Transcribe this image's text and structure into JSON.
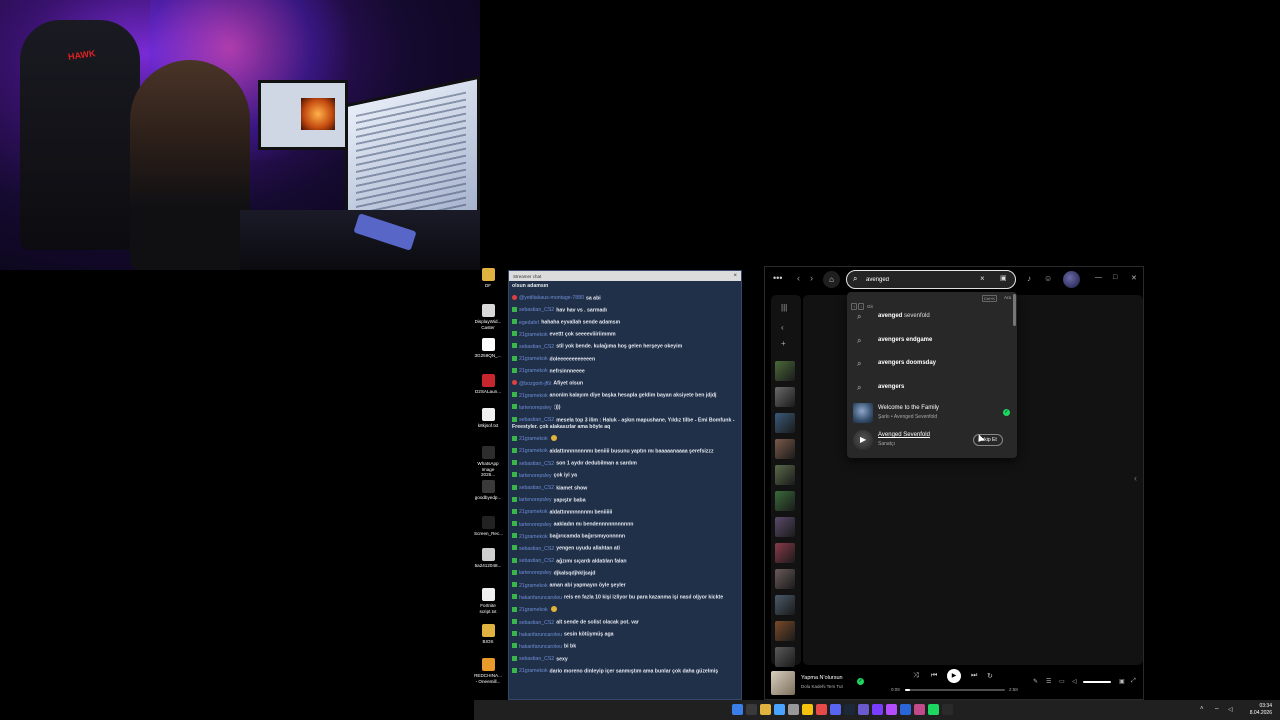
{
  "chat": {
    "title": "Streamer chat",
    "messages": [
      {
        "badge": "",
        "user": "",
        "text": "olsun adamsın"
      },
      {
        "badge": "red",
        "user": "@yetiltakaus-montage-7880",
        "text": "sa abi"
      },
      {
        "badge": "green",
        "user": "sebastian_CS2",
        "text": "hav hav vs . sarmadı"
      },
      {
        "badge": "green",
        "user": "egedahrl",
        "text": "hahaha eyvallah sende adamsın"
      },
      {
        "badge": "green",
        "user": "21gramekok",
        "text": "evettt çok seeeeviiiriimmm"
      },
      {
        "badge": "green",
        "user": "sebastian_CS2",
        "text": "stil yok bende. kulağıma hoş gelen herşeye okeyim"
      },
      {
        "badge": "green",
        "user": "21gramekok",
        "text": "doleeeeeeeeeeeen"
      },
      {
        "badge": "green",
        "user": "21gramekok",
        "text": "nefrsinnneeee"
      },
      {
        "badge": "red",
        "user": "@bozgorit-jf6t",
        "text": "Afiyet olsun"
      },
      {
        "badge": "green",
        "user": "21gramekok",
        "text": "anonim kalayım diye başka hesapla geldim bayan aksiyete ben jdjdj"
      },
      {
        "badge": "green",
        "user": "lartenorepsley",
        "text": ":)))"
      },
      {
        "badge": "green",
        "user": "sebastian_CS2",
        "text": "mesela top 3 ilim : Haluk - aşkın mapushane, Yıldız tilbe - Emi Bomfunk - Freestyler. çok alakasızlar ama böyle aq"
      },
      {
        "badge": "green",
        "user": "21gramekok",
        "text": ""
      },
      {
        "badge": "green",
        "user": "21gramekok",
        "text": "aldattınnnnnnnmı beniiii busunu yaptın mı baaaaanaaaa şerefsizzz"
      },
      {
        "badge": "green",
        "user": "sebastian_CS2",
        "text": "son 1 aydır dedubilman a sardım"
      },
      {
        "badge": "green",
        "user": "lartenorepsley",
        "text": "çok iyi ya"
      },
      {
        "badge": "green",
        "user": "sebastian_CS2",
        "text": "kiamet show"
      },
      {
        "badge": "green",
        "user": "lartenorepsley",
        "text": "yapıştır baba"
      },
      {
        "badge": "green",
        "user": "21gramekok",
        "text": "aldattınnnnnnnmı beniiiiii"
      },
      {
        "badge": "green",
        "user": "lartenorepsley",
        "text": "aakladın mı bendennnnnnnnnnn"
      },
      {
        "badge": "green",
        "user": "21gramekok",
        "text": "bağırıcamda bağırsmıyonnnnn"
      },
      {
        "badge": "green",
        "user": "sebastian_CS2",
        "text": "yengen uyudu allahtan ati"
      },
      {
        "badge": "green",
        "user": "sebastian_CS2",
        "text": "ağzımı sıçardı aldatılan falan"
      },
      {
        "badge": "green",
        "user": "lartenorepsley",
        "text": "djkalsqdjhkljsajd"
      },
      {
        "badge": "green",
        "user": "21gramekok",
        "text": "aman abi yapmayın öyle şeyler"
      },
      {
        "badge": "green",
        "user": "hakanfaruncaroleu",
        "text": "reis en fazla 10 kişi izliyor bu para kazanma işi nasıl oljyor kickte"
      },
      {
        "badge": "green",
        "user": "21gramekok",
        "text": ""
      },
      {
        "badge": "green",
        "user": "sebastian_CS2",
        "text": "alt sende de solist olacak pot. var"
      },
      {
        "badge": "green",
        "user": "hakanfaruncaroleu",
        "text": "sesin kötüymüş aga"
      },
      {
        "badge": "green",
        "user": "hakanfaruncaroleu",
        "text": "bi bk"
      },
      {
        "badge": "green",
        "user": "sebastian_CS2",
        "text": "sexy"
      },
      {
        "badge": "green",
        "user": "21gramekok",
        "text": "dario moreno dinleyip içer sanmıştım ama bunlar çok daha güzelmiş"
      }
    ]
  },
  "desktop_icons": [
    {
      "label": "DF",
      "color": "#e0b341"
    },
    {
      "label": "DisplayWid... Caster",
      "color": "#d8d8d8"
    },
    {
      "label": "3G259QN_...",
      "color": "#ffffff"
    },
    {
      "label": "D2SALaun...",
      "color": "#c8262f"
    },
    {
      "label": "k8kjsof.txt",
      "color": "#f0f0f0"
    },
    {
      "label": "WhatsApp Image 2026...",
      "color": "#2d2d2d"
    },
    {
      "label": "goodbyedp...",
      "color": "#3a3a3a"
    },
    {
      "label": "Screen_Rec...",
      "color": "#222"
    },
    {
      "label": "5a2412048...",
      "color": "#cfcfcf"
    },
    {
      "label": "Fortnite script.txt",
      "color": "#f0f0f0"
    },
    {
      "label": "BIOS",
      "color": "#e0b341"
    },
    {
      "label": "REDCHINA... - Oneemill...",
      "color": "#e89a2a"
    }
  ],
  "spotify": {
    "search_value": "avenged",
    "dropdown": {
      "keys": [
        "↑",
        "↓"
      ],
      "select_hint": "Git",
      "clear_key": "Ctrl+K",
      "search_hint": "Ara",
      "suggestions": [
        {
          "bold": "avenged",
          "rest": " sevenfold"
        },
        {
          "bold": "avengers endgame",
          "rest": ""
        },
        {
          "bold": "avengers doomsday",
          "rest": ""
        },
        {
          "bold": "avengers",
          "rest": ""
        }
      ],
      "song": {
        "title": "Welcome to the Family",
        "subtitle": "Şarkı • Avenged Sevenfold"
      },
      "artist": {
        "title": "Avenged Sevenfold",
        "subtitle": "Sanatçı",
        "follow_label": "Takip Et"
      }
    },
    "player": {
      "song": "Yapma N'olursun",
      "artist": "Dolu Kadehi Ters Tut",
      "elapsed": "0:09",
      "duration": "2:58",
      "progress": 0.05
    }
  },
  "taskbar": {
    "time": "03:34",
    "date": "8.04.2026",
    "apps": [
      "#3c7ee8",
      "#3a3a3a",
      "#e0b341",
      "#4aa3ff",
      "#999",
      "#f4c20d",
      "#e84a4a",
      "#5865f2",
      "#1b2838",
      "#6a5acd",
      "#7a3cff",
      "#b34dff",
      "#2b66d9",
      "#c04a8a",
      "#1ed760",
      "#2a2a2a"
    ]
  }
}
